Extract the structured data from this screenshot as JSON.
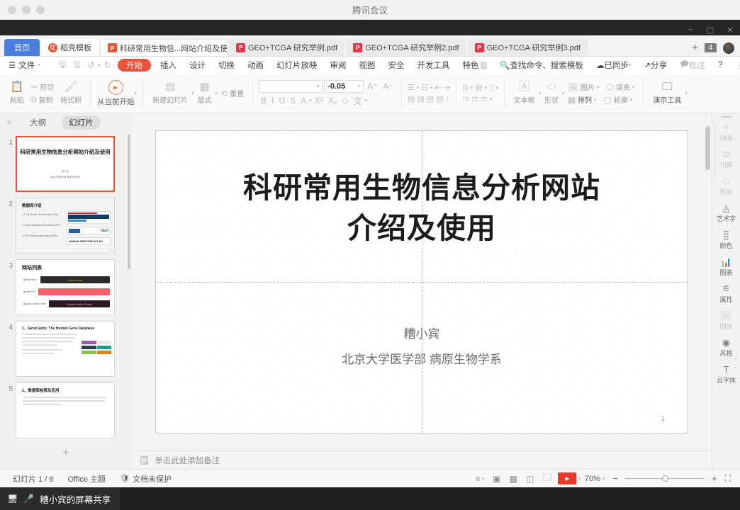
{
  "window": {
    "mac_title": "腾讯会议",
    "controls": [
      "minimize",
      "maximize",
      "close"
    ]
  },
  "tabbar": {
    "home_label": "首页",
    "tabs": [
      {
        "label": "稻壳模板",
        "icon": "docer-icon",
        "state": "normal"
      },
      {
        "label": "科研常用生物信...网站介绍及使用",
        "icon": "ppt-icon",
        "state": "active",
        "modified": true
      },
      {
        "label": "GEO+TCGA 研究举例.pdf",
        "icon": "pdf-icon",
        "state": "inactive"
      },
      {
        "label": "GEO+TCGA 研究举例2.pdf",
        "icon": "pdf-icon",
        "state": "inactive"
      },
      {
        "label": "GEO+TCGA 研究举例3.pdf",
        "icon": "pdf-icon",
        "state": "inactive"
      }
    ],
    "new_tab": "+",
    "tab_count": "4"
  },
  "menu": {
    "file_label": "文件",
    "quick": [
      "save-icon",
      "save-as-icon",
      "undo-icon",
      "redo-icon"
    ],
    "items": [
      {
        "label": "开始",
        "active": true
      },
      {
        "label": "插入",
        "active": false
      },
      {
        "label": "设计",
        "active": false
      },
      {
        "label": "切换",
        "active": false
      },
      {
        "label": "动画",
        "active": false
      },
      {
        "label": "幻灯片放映",
        "active": false
      },
      {
        "label": "审阅",
        "active": false
      },
      {
        "label": "视图",
        "active": false
      },
      {
        "label": "安全",
        "active": false
      },
      {
        "label": "开发工具",
        "active": false
      },
      {
        "label": "特色",
        "active": false
      }
    ],
    "search_placeholder": "查找命令、搜索模板",
    "sync_label": "已同步",
    "share_label": "分享",
    "comment_label": "批注",
    "help_label": "?",
    "more_label": "⋮",
    "collapse_label": "︿"
  },
  "ribbon": {
    "paste": "粘贴",
    "cut": "剪切",
    "copy": "复制",
    "format_painter": "格式刷",
    "start_from_current": "从当前开始",
    "new_slide": "新建幻灯片",
    "layout": "版式",
    "reset": "重置",
    "font_name": "",
    "font_name_placeholder": "",
    "font_size": "-0.05",
    "grow_font": "A",
    "shrink_font": "A",
    "bold": "B",
    "italic": "I",
    "underline": "U",
    "strikethrough": "S",
    "text_color": "A",
    "superscript": "X²",
    "subscript": "X₂",
    "clear_format": "◇",
    "pinyin": "文",
    "textbox": "文本框",
    "shape": "形状",
    "picture": "图片",
    "fill": "填充",
    "arrange": "排列",
    "outline": "轮廓",
    "present_tools": "演示工具"
  },
  "left_panel": {
    "collapse_icon": "«",
    "tab_outline": "大纲",
    "tab_slides": "幻灯片",
    "selected_tab": "幻灯片",
    "add_slide": "+",
    "slides": [
      {
        "num": "1",
        "kind": "title",
        "title": "科研常用生物信息分析网站介绍及使用",
        "author": "糟小宾",
        "org": "北京大学医学部 病原生物学系",
        "selected": true
      },
      {
        "num": "2",
        "kind": "content",
        "title": "数据库介绍",
        "selected": false
      },
      {
        "num": "3",
        "kind": "list",
        "title": "网站列表",
        "selected": false
      },
      {
        "num": "4",
        "kind": "text",
        "title": "1、GeneCards: The Human Gene Database",
        "selected": false
      },
      {
        "num": "5",
        "kind": "text",
        "title": "2、数据库检索及应用",
        "selected": false
      }
    ]
  },
  "slide": {
    "title_line1": "科研常用生物信息分析网站",
    "title_line2": "介绍及使用",
    "author": "糟小宾",
    "organization": "北京大学医学部 病原生物学系",
    "page_number": "1"
  },
  "notes": {
    "placeholder": "单击此处添加备注",
    "icon": "notes-icon"
  },
  "right_bar": {
    "items": [
      {
        "label": "动画",
        "icon": "animation-icon",
        "state": "dim"
      },
      {
        "label": "切换",
        "icon": "transition-icon",
        "state": "dim"
      },
      {
        "label": "形状",
        "icon": "shape-icon",
        "state": "dim"
      },
      {
        "label": "艺术字",
        "icon": "wordart-icon",
        "state": "strong"
      },
      {
        "label": "颜色",
        "icon": "color-icon",
        "state": "strong"
      },
      {
        "label": "图表",
        "icon": "chart-icon",
        "state": "strong"
      },
      {
        "label": "属性",
        "icon": "properties-icon",
        "state": "strong"
      },
      {
        "label": "图库",
        "icon": "gallery-icon",
        "state": "dim"
      },
      {
        "label": "风格",
        "icon": "style-icon",
        "state": "strong"
      },
      {
        "label": "云字体",
        "icon": "cloudfont-icon",
        "state": "strong"
      }
    ]
  },
  "status_bar": {
    "slide_counter": "幻灯片 1 / 6",
    "theme": "Office 主题",
    "protection": "文档未保护",
    "protection_icon": "shield-icon",
    "views": [
      "outline-view-icon",
      "normal-view-icon",
      "slide-sorter-icon",
      "reading-view-icon",
      "notes-view-icon"
    ],
    "play_label": "▶",
    "zoom_level": "70%",
    "zoom_out": "−",
    "zoom_in": "+",
    "fit_label": "fit-to-window-icon"
  },
  "share_bar": {
    "screen_icon": "screen-share-icon",
    "mic_icon": "microphone-icon",
    "label": "糟小宾的屏幕共享"
  },
  "colors": {
    "accent_orange": "#e8533b",
    "home_blue": "#4a7fe0",
    "pdf_red": "#e8344b",
    "play_red": "#e8392b",
    "dark_strip": "#262626",
    "share_bar": "#1f1f1f"
  }
}
